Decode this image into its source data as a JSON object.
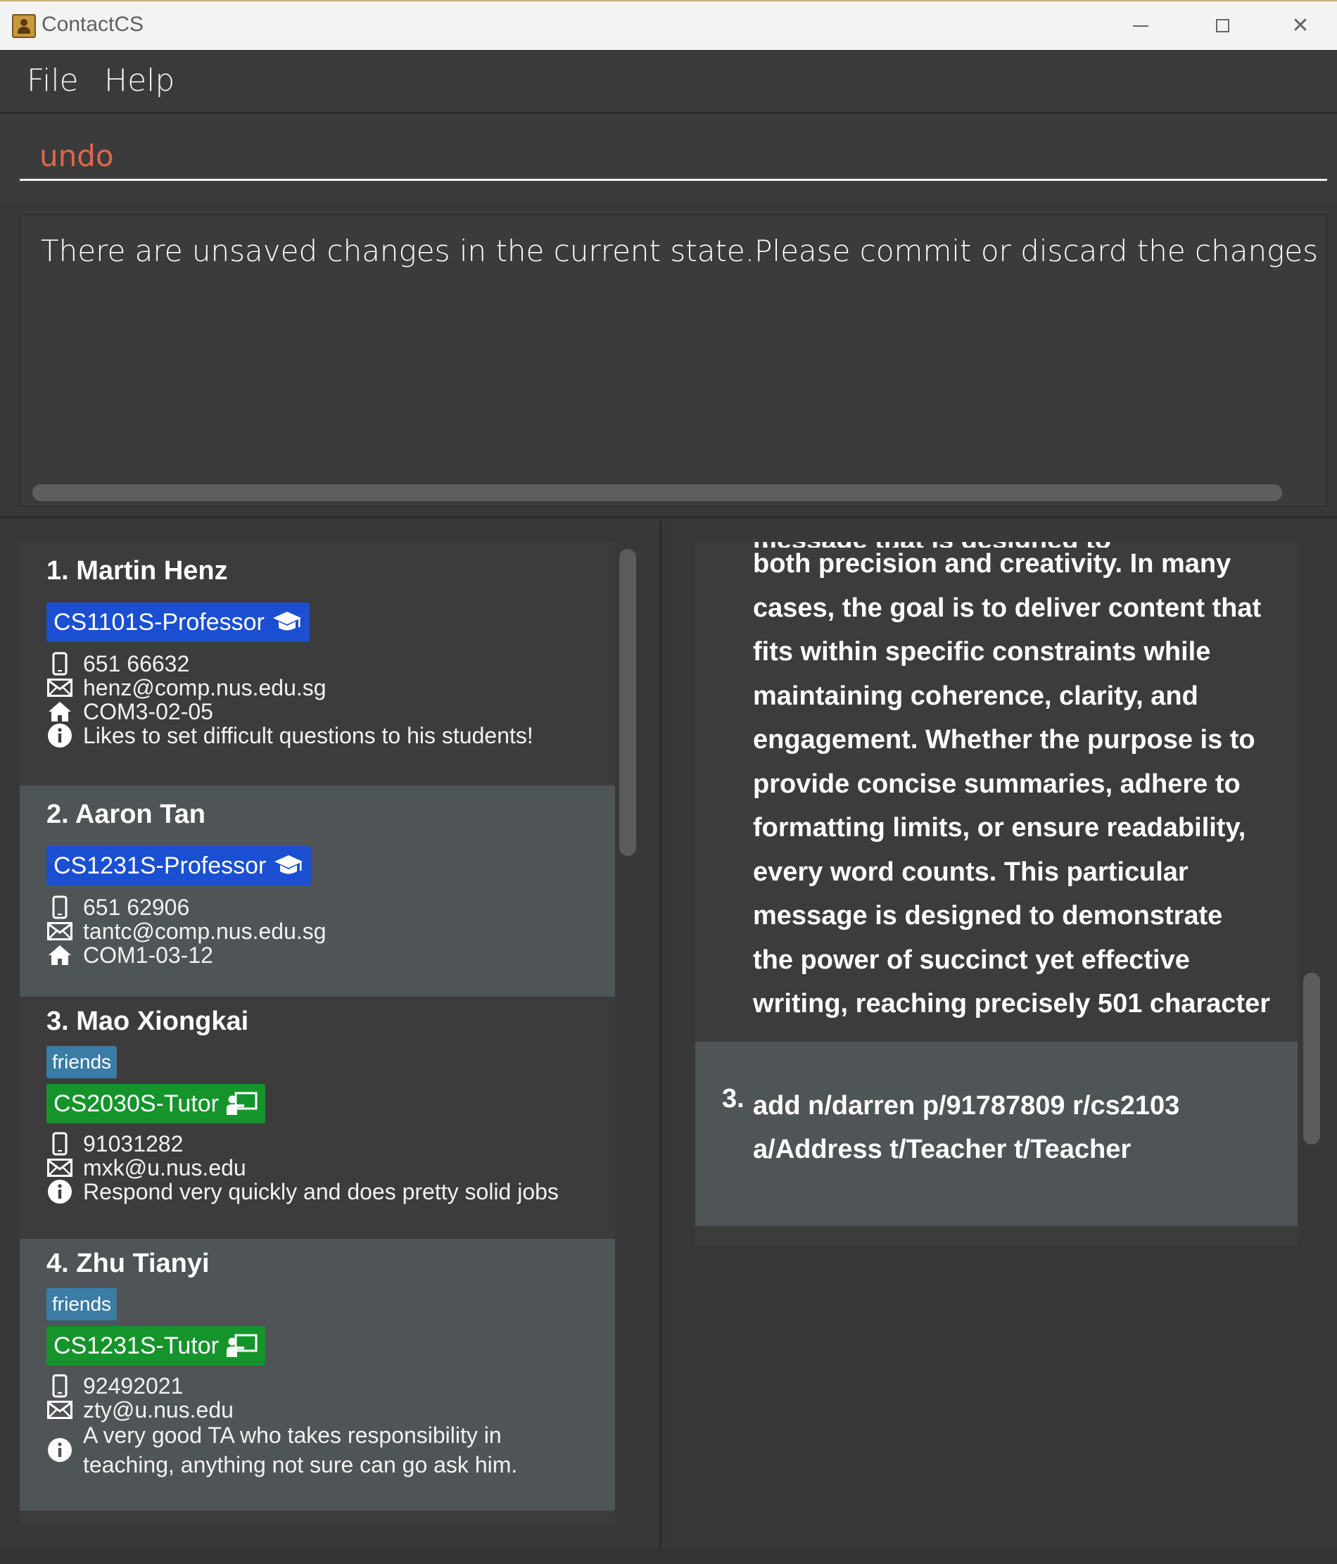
{
  "window": {
    "title": "ContactCS",
    "minimize_icon": "minimize-icon",
    "maximize_icon": "maximize-icon",
    "close_icon": "close-icon"
  },
  "menu": {
    "file": "File",
    "help": "Help"
  },
  "command": {
    "value": "undo",
    "text_color": "#e0664a"
  },
  "result": {
    "message": "There are unsaved changes in the current state.Please commit or discard the changes before undoing"
  },
  "colors": {
    "professor_tag": "#1a4fd1",
    "tutor_tag": "#15942c",
    "friends_tag": "#3a7ca5"
  },
  "persons": [
    {
      "index": "1.",
      "name": "Martin Henz",
      "tags": [],
      "role": {
        "label": "CS1101S-Professor",
        "kind": "professor",
        "icon": "graduation-cap-icon"
      },
      "phone": "651 66632",
      "email": "henz@comp.nus.edu.sg",
      "address": "COM3-02-05",
      "remark": "Likes to set difficult questions to his students!"
    },
    {
      "index": "2.",
      "name": "Aaron Tan",
      "tags": [],
      "role": {
        "label": "CS1231S-Professor",
        "kind": "professor",
        "icon": "graduation-cap-icon"
      },
      "phone": "651 62906",
      "email": "tantc@comp.nus.edu.sg",
      "address": "COM1-03-12",
      "remark": ""
    },
    {
      "index": "3.",
      "name": "Mao Xiongkai",
      "tags": [
        "friends"
      ],
      "role": {
        "label": "CS2030S-Tutor",
        "kind": "tutor",
        "icon": "teacher-board-icon"
      },
      "phone": "91031282",
      "email": "mxk@u.nus.edu",
      "address": "",
      "remark": "Respond very quickly and does pretty solid jobs"
    },
    {
      "index": "4.",
      "name": "Zhu Tianyi",
      "tags": [
        "friends"
      ],
      "role": {
        "label": "CS1231S-Tutor",
        "kind": "tutor",
        "icon": "teacher-board-icon"
      },
      "phone": "92492021",
      "email": "zty@u.nus.edu",
      "address": "",
      "remark_line1": "A very good TA who takes responsibility in",
      "remark_line2": "teaching, anything not sure can go ask him."
    }
  ],
  "history": {
    "clipped_line": "message that is designed to demonstrate",
    "paragraph_lines": [
      "both precision and creativity. In many",
      "cases, the goal is to deliver content that",
      "fits within specific constraints while",
      "maintaining coherence, clarity, and",
      "engagement. Whether the purpose is to",
      "provide concise summaries, adhere to",
      "formatting limits, or ensure readability,",
      "every word counts. This particular",
      "message is designed to demonstrate",
      "the power of succinct yet effective",
      "writing, reaching precisely 501 character"
    ],
    "item3_index": "3.",
    "item3_line1": "add n/darren p/91787809 r/cs2103",
    "item3_line2": "a/Address t/Teacher t/Teacher"
  }
}
